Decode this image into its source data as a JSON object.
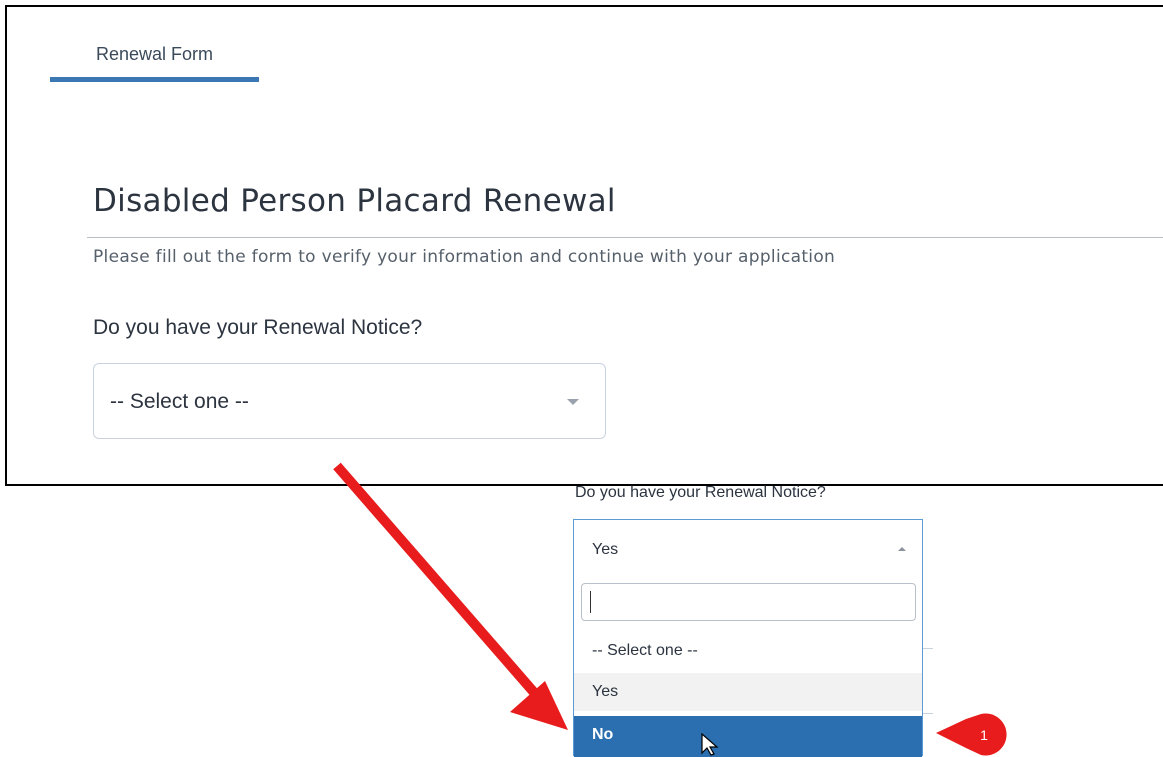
{
  "tab": {
    "label": "Renewal Form"
  },
  "page": {
    "title": "Disabled Person Placard Renewal",
    "subtitle": "Please fill out the form to verify your information and continue with your application"
  },
  "question": {
    "label": "Do you have your Renewal Notice?",
    "select_value": "-- Select one --"
  },
  "zoomed_dropdown": {
    "label": "Do you have your Renewal Notice?",
    "current_value": "Yes",
    "search_value": "",
    "options": [
      "-- Select one --",
      "Yes",
      "No"
    ],
    "highlighted_option": "No"
  },
  "annotation": {
    "badge_number": "1",
    "color": "#e81c1c"
  },
  "colors": {
    "accent": "#3b77b3",
    "highlight": "#2c6fb0"
  }
}
